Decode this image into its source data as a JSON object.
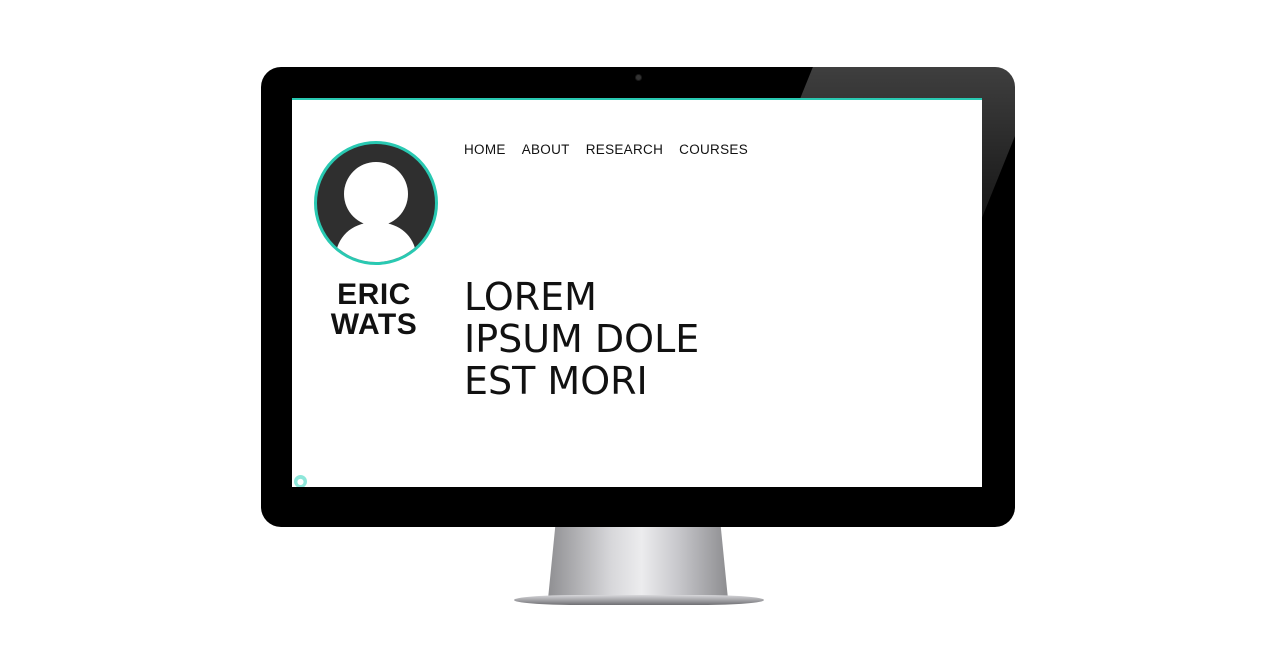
{
  "profile": {
    "first_name": "ERIC",
    "last_name": "WATS"
  },
  "nav": {
    "items": [
      "HOME",
      "ABOUT",
      "RESEARCH",
      "COURSES"
    ]
  },
  "hero": {
    "line1": "LOREM",
    "line2": "IPSUM DOLE",
    "line3": "EST MORI"
  },
  "colors": {
    "accent": "#29c9b2",
    "text": "#111111",
    "avatar_bg": "#2f2f2f"
  },
  "icons": {
    "avatar": "user-silhouette-icon",
    "corner_bubble": "help-bubble-icon"
  }
}
